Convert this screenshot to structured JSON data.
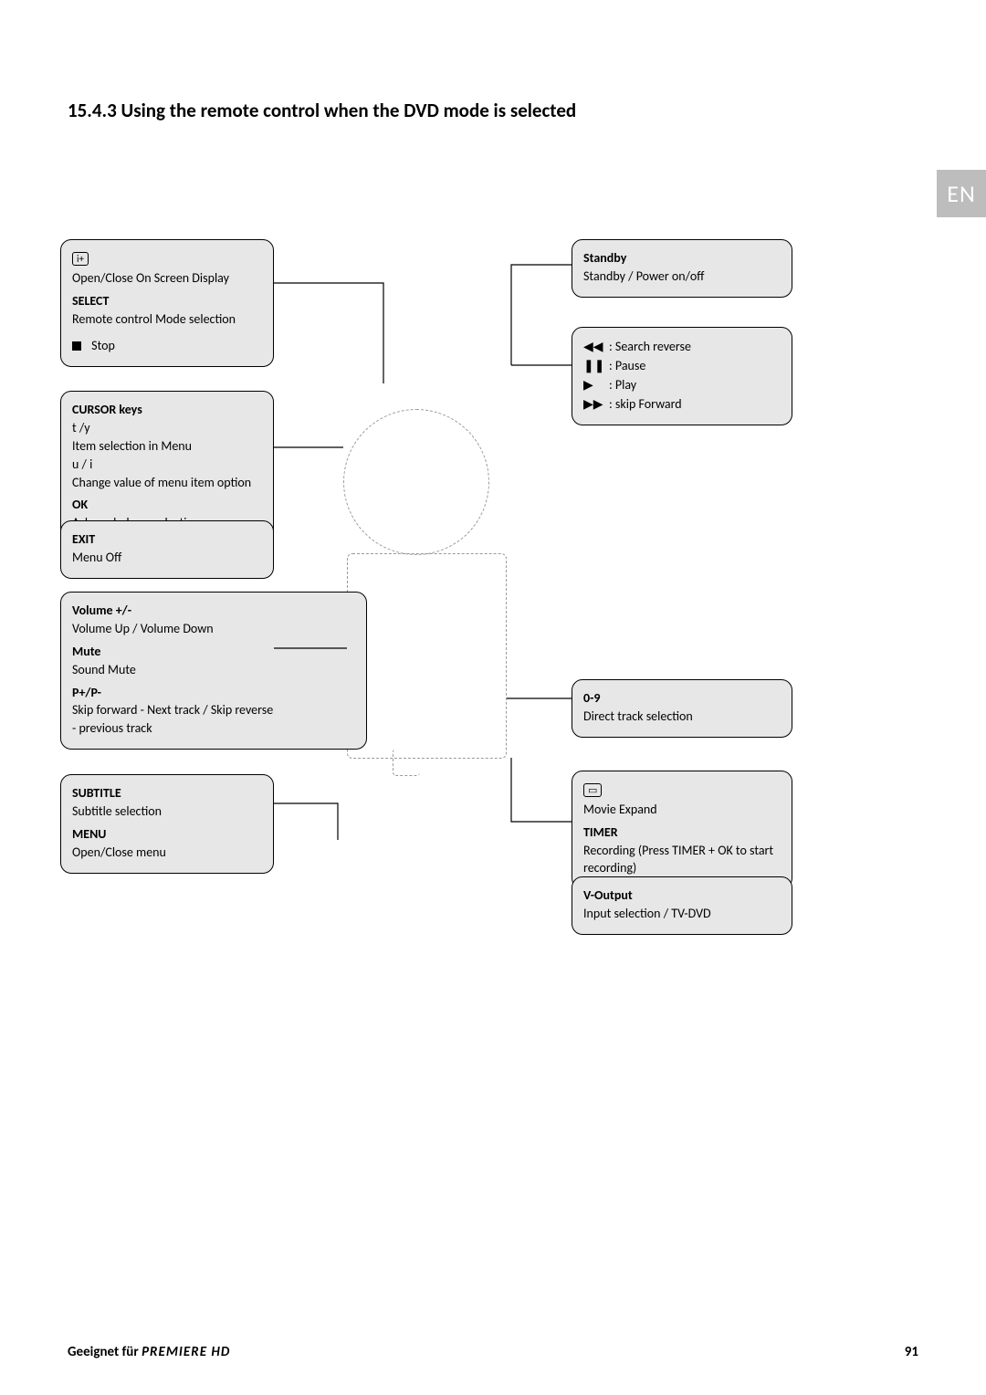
{
  "heading": "15.4.3 Using the remote control when the DVD mode is selected",
  "lang": "EN",
  "left": {
    "box1": {
      "osd_desc": "Open/Close On Screen Display",
      "select_title": "SELECT",
      "select_desc": "Remote control Mode selection",
      "stop_label": "Stop"
    },
    "box2": {
      "cursor_title": "CURSOR keys",
      "cursor_line1": "t  /y",
      "cursor_line2": "Item selection in Menu",
      "cursor_line3": "u  / i",
      "cursor_line4": "Change value of menu item option",
      "ok_title": "OK",
      "ok_desc": "Acknowledge a selection"
    },
    "box3": {
      "exit_title": "EXIT",
      "exit_desc": "Menu Off"
    },
    "box4": {
      "vol_title": "Volume      +/-",
      "vol_desc": "Volume Up / Volume Down",
      "mute_title": "Mute",
      "mute_desc": "Sound Mute",
      "pp_title": "P+/P-",
      "pp_desc1": "Skip forward - Next track / Skip reverse",
      "pp_desc2": "- previous track"
    },
    "box5": {
      "sub_title": "SUBTITLE",
      "sub_desc": "Subtitle selection",
      "menu_title": "MENU",
      "menu_desc": "Open/Close menu"
    }
  },
  "right": {
    "box1": {
      "standby_title": "Standby",
      "standby_desc": "Standby / Power on/off"
    },
    "box2": {
      "r1_glyph": "◀◀",
      "r1_desc": ": Search reverse",
      "r2_glyph": "❚❚",
      "r2_desc": ": Pause",
      "r3_glyph": "▶",
      "r3_desc": ": Play",
      "r4_glyph": "▶▶",
      "r4_desc": ": skip Forward"
    },
    "box3": {
      "num_title": "0-9",
      "num_desc": "Direct track selection"
    },
    "box4": {
      "expand_desc": "Movie Expand",
      "timer_title": "TIMER",
      "timer_desc": "Recording (Press TIMER + OK to start recording)"
    },
    "box5": {
      "vout_title": "V-Output",
      "vout_desc": "Input selection / TV-DVD"
    }
  },
  "footer": {
    "prefix": "Geeignet für ",
    "brand": "PREMIERE HD",
    "page": "91"
  }
}
